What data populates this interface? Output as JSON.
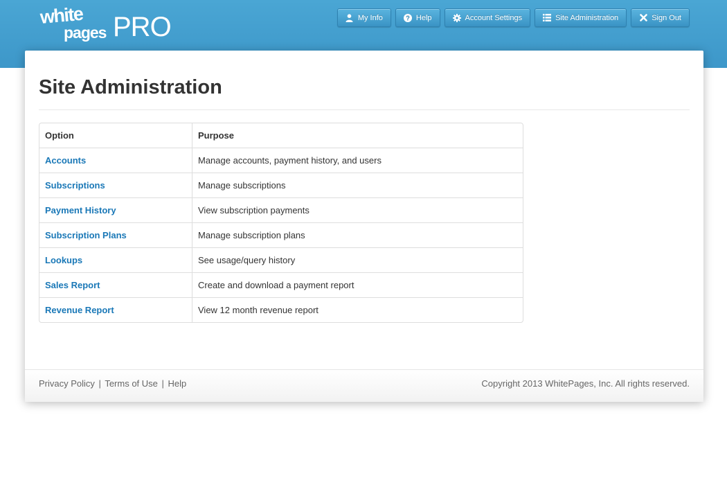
{
  "logo": {
    "line1": "white",
    "line2": "pages",
    "suffix": "PRO"
  },
  "nav": [
    {
      "icon": "user-icon",
      "label": "My Info"
    },
    {
      "icon": "help-icon",
      "label": "Help"
    },
    {
      "icon": "gear-icon",
      "label": "Account Settings"
    },
    {
      "icon": "list-icon",
      "label": "Site Administration"
    },
    {
      "icon": "close-icon",
      "label": "Sign Out"
    }
  ],
  "page": {
    "title": "Site Administration"
  },
  "table": {
    "headers": [
      "Option",
      "Purpose"
    ],
    "rows": [
      {
        "option": "Accounts",
        "purpose": "Manage accounts, payment history, and users"
      },
      {
        "option": "Subscriptions",
        "purpose": "Manage subscriptions"
      },
      {
        "option": "Payment History",
        "purpose": "View subscription payments"
      },
      {
        "option": "Subscription Plans",
        "purpose": "Manage subscription plans"
      },
      {
        "option": "Lookups",
        "purpose": "See usage/query history"
      },
      {
        "option": "Sales Report",
        "purpose": "Create and download a payment report"
      },
      {
        "option": "Revenue Report",
        "purpose": "View 12 month revenue report"
      }
    ]
  },
  "footer": {
    "links": [
      "Privacy Policy",
      "Terms of Use",
      "Help"
    ],
    "separator": "|",
    "copyright": "Copyright 2013 WhitePages, Inc. All rights reserved."
  },
  "colors": {
    "header": "#4aa6d4",
    "link": "#1a78b7"
  }
}
